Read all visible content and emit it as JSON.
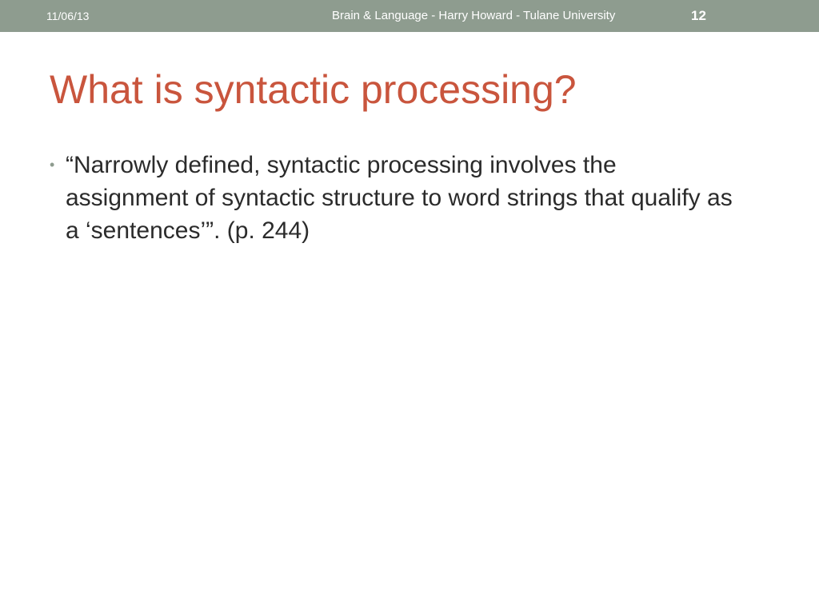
{
  "header": {
    "date": "11/06/13",
    "footer": "Brain & Language - Harry Howard - Tulane University",
    "slide_number": "12"
  },
  "slide": {
    "title": "What is syntactic processing?",
    "bullets": [
      {
        "marker": "•",
        "text": "“Narrowly defined, syntactic processing involves the assignment of syntactic structure to word strings that qualify as a ‘sentences’”. (p. 244)"
      }
    ]
  },
  "colors": {
    "header_bar": "#8e9c8f",
    "title": "#c9553d",
    "body_text": "#2b2b2b"
  }
}
